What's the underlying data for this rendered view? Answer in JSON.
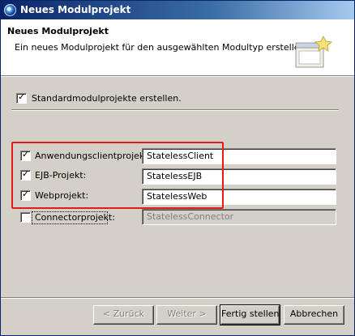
{
  "window": {
    "title": "Neues Modulprojekt"
  },
  "banner": {
    "title": "Neues Modulprojekt",
    "description": "Ein neues Modulprojekt für den ausgewählten Modultyp erstellen"
  },
  "standard": {
    "label": "Standardmodulprojekte erstellen.",
    "checked": true
  },
  "modules": [
    {
      "label": "Anwendungsclientprojekt:",
      "checked": true,
      "value": "StatelessClient",
      "enabled": true
    },
    {
      "label": "EJB-Projekt:",
      "checked": true,
      "value": "StatelessEJB",
      "enabled": true
    },
    {
      "label": "Webprojekt:",
      "checked": true,
      "value": "StatelessWeb",
      "enabled": true
    },
    {
      "label": "Connectorprojekt:",
      "checked": false,
      "value": "StatelessConnector",
      "enabled": false
    }
  ],
  "buttons": {
    "back": "< Zurück",
    "next": "Weiter >",
    "finish": "Fertig stellen",
    "cancel": "Abbrechen"
  },
  "colors": {
    "highlight": "#e41b1b",
    "titlebar": "#0a246a"
  },
  "icons": {
    "window": "eclipse-icon",
    "banner": "new-module-wizard-icon",
    "check": "checkmark-icon"
  }
}
